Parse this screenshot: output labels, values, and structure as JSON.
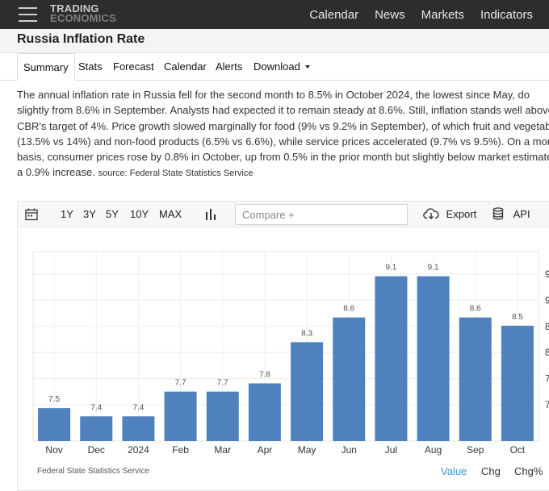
{
  "nav": {
    "logo_line1": "TRADING",
    "logo_line2": "ECONOMICS",
    "links": [
      "Calendar",
      "News",
      "Markets",
      "Indicators"
    ]
  },
  "page": {
    "title": "Russia Inflation Rate"
  },
  "tabs": {
    "items": [
      "Summary",
      "Stats",
      "Forecast",
      "Calendar",
      "Alerts",
      "Download"
    ],
    "active": "Summary"
  },
  "summary": {
    "lines": [
      "The annual inflation rate in Russia fell for the second month to 8.5% in October 2024, the lowest since May, do",
      "slightly from 8.6% in September. Analysts had expected it to remain steady at 8.6%. Still, inflation stands well above",
      "CBR's target of 4%. Price growth slowed marginally for food (9% vs 9.2% in September), of which fruit and vegetab",
      "(13.5% vs 14%) and non-food products (6.5% vs 6.6%), while service prices accelerated (9.7% vs 9.5%). On a mon",
      "basis, consumer prices rose by 0.8% in October, up from 0.5% in the prior month but slightly below market estimate",
      "a 0.9% increase."
    ],
    "source": "source: Federal State Statistics Service"
  },
  "toolbar": {
    "ranges": [
      "1Y",
      "3Y",
      "5Y",
      "10Y",
      "MAX"
    ],
    "compare_placeholder": "Compare +",
    "export_label": "Export",
    "api_label": "API"
  },
  "chart_footer": {
    "source": "Federal State Statistics Service",
    "value_label": "Value",
    "chg_label": "Chg",
    "chgpct_label": "Chg%"
  },
  "colors": {
    "bar": "#4f81bd",
    "nav_bg": "#2d2d2d",
    "value_link": "#3d8fd6"
  },
  "chart_data": {
    "type": "bar",
    "categories": [
      "Nov",
      "Dec",
      "2024",
      "Feb",
      "Mar",
      "Apr",
      "May",
      "Jun",
      "Jul",
      "Aug",
      "Sep",
      "Oct"
    ],
    "values": [
      7.5,
      7.4,
      7.4,
      7.7,
      7.7,
      7.8,
      8.3,
      8.6,
      9.1,
      9.1,
      8.6,
      8.5
    ],
    "data_labels": [
      "7.5",
      "7.4",
      "7.4",
      "7.7",
      "7.7",
      "7.8",
      "8.3",
      "8.6",
      "9.1",
      "9.1",
      "8.6",
      "8.5"
    ],
    "y_tick_labels": [
      "9",
      "9",
      "8",
      "8",
      "7",
      "7"
    ],
    "ylim": [
      7.1,
      9.4
    ],
    "grid": true
  }
}
